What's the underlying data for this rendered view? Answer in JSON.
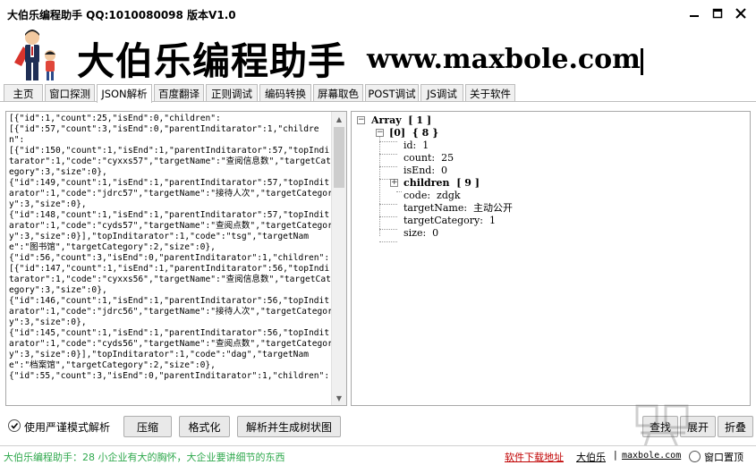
{
  "window": {
    "title": "大伯乐编程助手 QQ:1010080098 版本V1.0"
  },
  "banner": {
    "brand_cn": "大伯乐编程助手",
    "brand_url": "www.maxbole.com"
  },
  "tabs": [
    {
      "label": "主页"
    },
    {
      "label": "窗口探测"
    },
    {
      "label": "JSON解析",
      "active": true
    },
    {
      "label": "百度翻译"
    },
    {
      "label": "正则调试"
    },
    {
      "label": "编码转换"
    },
    {
      "label": "屏幕取色"
    },
    {
      "label": "POST调试"
    },
    {
      "label": "JS调试"
    },
    {
      "label": "关于软件"
    }
  ],
  "json_input": {
    "text": "[{\"id\":1,\"count\":25,\"isEnd\":0,\"children\":\n[{\"id\":57,\"count\":3,\"isEnd\":0,\"parentInditarator\":1,\"children\":\n[{\"id\":150,\"count\":1,\"isEnd\":1,\"parentInditarator\":57,\"topInditarator\":1,\"code\":\"cyxxs57\",\"targetName\":\"查阅信息数\",\"targetCategory\":3,\"size\":0},\n{\"id\":149,\"count\":1,\"isEnd\":1,\"parentInditarator\":57,\"topInditarator\":1,\"code\":\"jdrc57\",\"targetName\":\"接待人次\",\"targetCategory\":3,\"size\":0},\n{\"id\":148,\"count\":1,\"isEnd\":1,\"parentInditarator\":57,\"topInditarator\":1,\"code\":\"cyds57\",\"targetName\":\"查阅点数\",\"targetCategory\":3,\"size\":0}],\"topInditarator\":1,\"code\":\"tsg\",\"targetName\":\"图书馆\",\"targetCategory\":2,\"size\":0},\n{\"id\":56,\"count\":3,\"isEnd\":0,\"parentInditarator\":1,\"children\":\n[{\"id\":147,\"count\":1,\"isEnd\":1,\"parentInditarator\":56,\"topInditarator\":1,\"code\":\"cyxxs56\",\"targetName\":\"查阅信息数\",\"targetCategory\":3,\"size\":0},\n{\"id\":146,\"count\":1,\"isEnd\":1,\"parentInditarator\":56,\"topInditarator\":1,\"code\":\"jdrc56\",\"targetName\":\"接待人次\",\"targetCategory\":3,\"size\":0},\n{\"id\":145,\"count\":1,\"isEnd\":1,\"parentInditarator\":56,\"topInditarator\":1,\"code\":\"cyds56\",\"targetName\":\"查阅点数\",\"targetCategory\":3,\"size\":0}],\"topInditarator\":1,\"code\":\"dag\",\"targetName\":\"档案馆\",\"targetCategory\":2,\"size\":0},\n{\"id\":55,\"count\":3,\"isEnd\":0,\"parentInditarator\":1,\"children\":"
  },
  "tree": {
    "root": "Array  [ 1 ]",
    "item0": "[0]  { 8 }",
    "fields": [
      "id:  1",
      "count:  25",
      "isEnd:  0",
      "children  [ 9 ]",
      "code:  zdgk",
      "targetName:  主动公开",
      "targetCategory:  1",
      "size:  0"
    ]
  },
  "actions": {
    "strict_mode_label": "使用严谨模式解析",
    "compress": "压缩",
    "format": "格式化",
    "parse_tree": "解析并生成树状图",
    "find": "查找",
    "expand": "展开",
    "collapse": "折叠"
  },
  "status": {
    "slogan": "大伯乐编程助手：28 小企业有大的胸怀，大企业要讲细节的东西",
    "download_link": "软件下载地址",
    "author_link": "大伯乐",
    "separator": "|",
    "site_link": "maxbole.com",
    "topmost_label": "窗口置顶"
  },
  "colors": {
    "slogan_green": "#2ea84c",
    "link_red": "#c00000",
    "border": "#a8a8a8"
  }
}
